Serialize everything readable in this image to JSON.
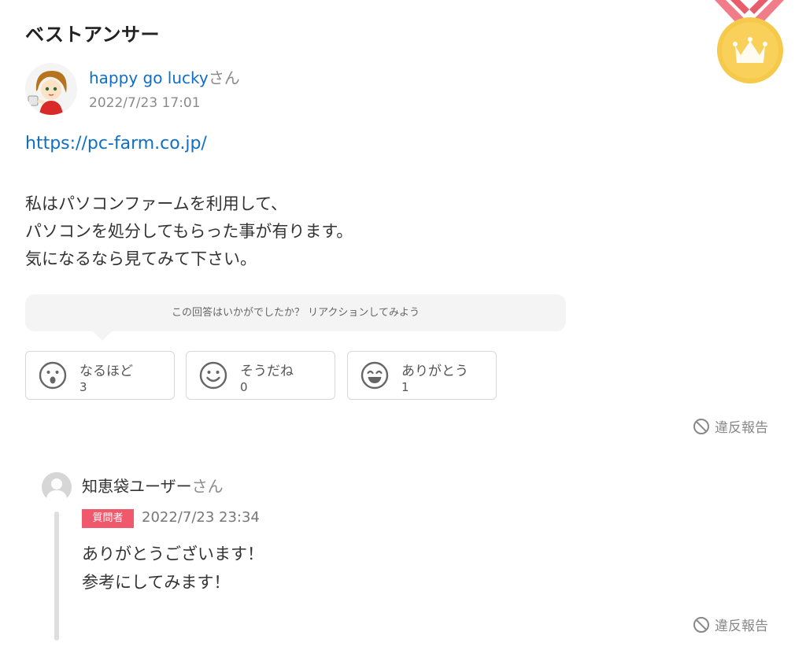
{
  "section_title": "ベストアンサー",
  "answer": {
    "user_name": "happy go lucky",
    "honorific": "さん",
    "datetime": "2022/7/23 17:01",
    "url": "https://pc-farm.co.jp/",
    "body_lines": [
      "私はパソコンファームを利用して、",
      "パソコンを処分してもらった事が有ります。",
      "気になるなら見てみて下さい。"
    ]
  },
  "reactions": {
    "prompt": "この回答はいかがでしたか？ リアクションしてみよう",
    "items": [
      {
        "label": "なるほど",
        "count": "3",
        "icon": "surprised-face-icon"
      },
      {
        "label": "そうだね",
        "count": "0",
        "icon": "smile-face-icon"
      },
      {
        "label": "ありがとう",
        "count": "1",
        "icon": "grin-face-icon"
      }
    ]
  },
  "report_label": "違反報告",
  "reply": {
    "user_name": "知恵袋ユーザー",
    "honorific": "さん",
    "badge": "質問者",
    "datetime": "2022/7/23 23:34",
    "body_lines": [
      "ありがとうございます！",
      "参考にしてみます！"
    ]
  },
  "colors": {
    "link": "#0f6fc6",
    "badge": "#f0586b",
    "medal_gold": "#f6c94a",
    "medal_ribbon": "#f07d87"
  }
}
